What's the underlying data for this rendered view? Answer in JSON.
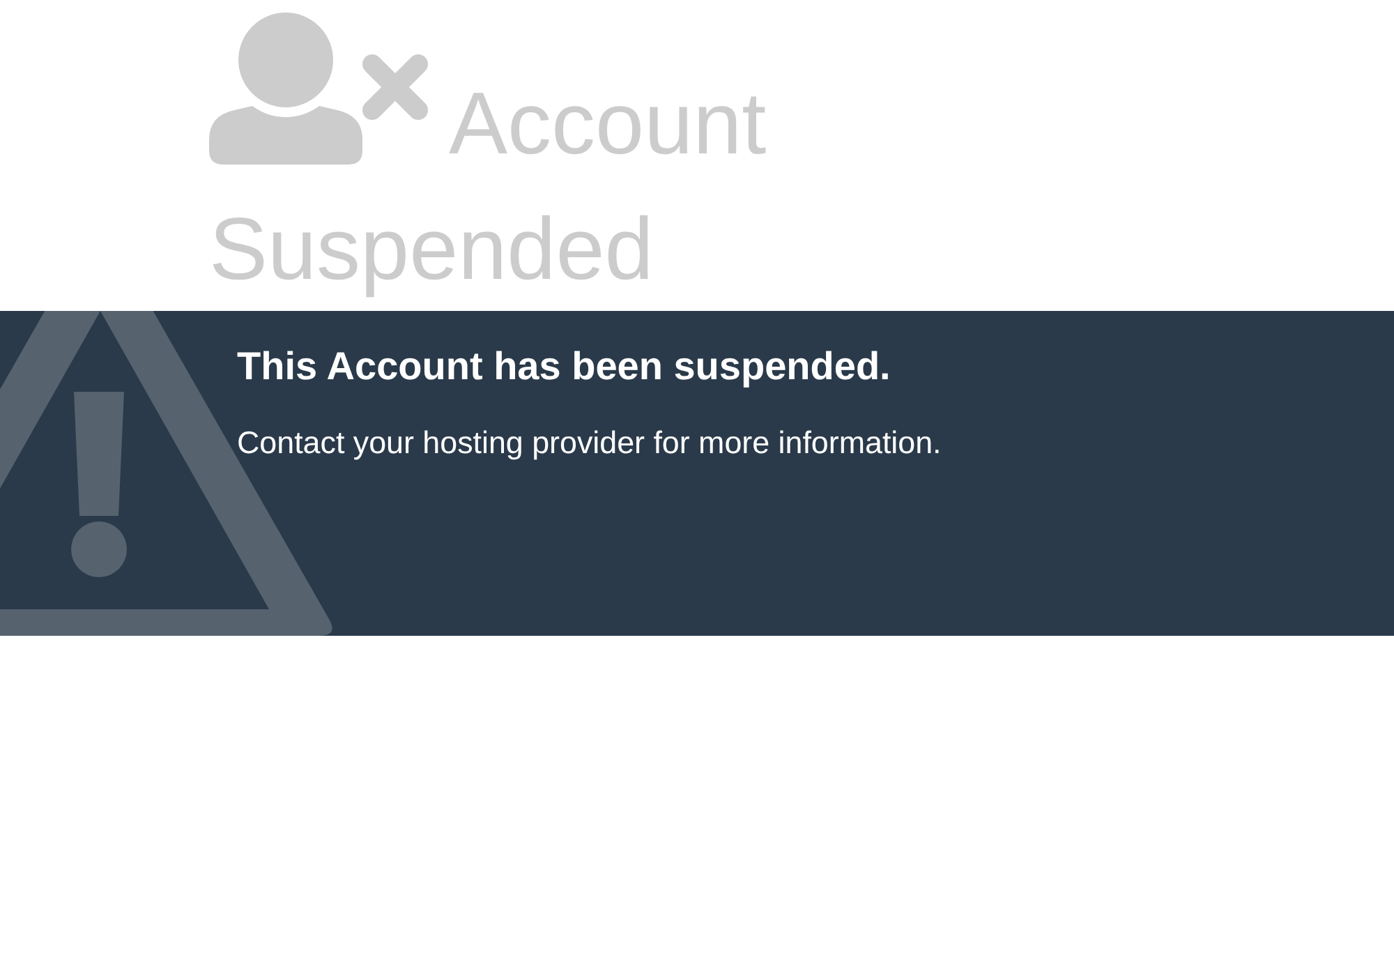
{
  "header": {
    "title_lines": [
      "Account",
      "Suspended"
    ]
  },
  "notice": {
    "heading": "This Account has been suspended.",
    "message": "Contact your hosting provider for more information."
  }
}
